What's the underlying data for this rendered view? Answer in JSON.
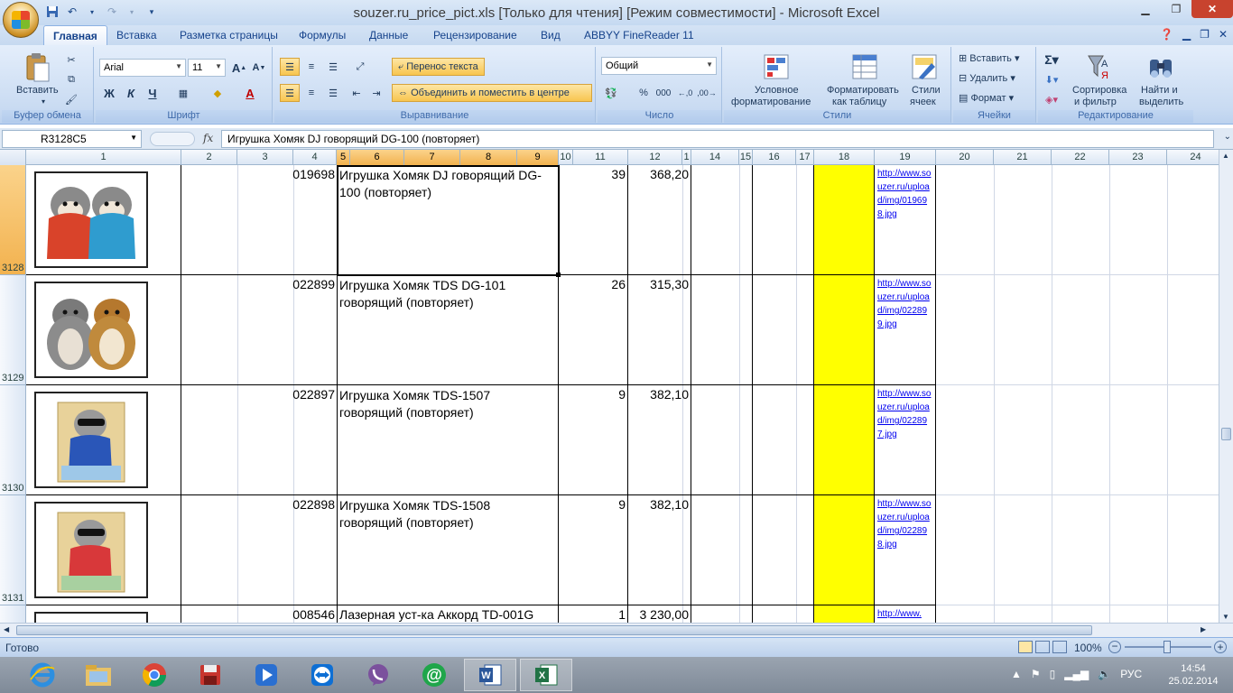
{
  "window": {
    "title": "souzer.ru_price_pict.xls  [Только для чтения]  [Режим совместимости] - Microsoft Excel"
  },
  "tabs": [
    "Главная",
    "Вставка",
    "Разметка страницы",
    "Формулы",
    "Данные",
    "Рецензирование",
    "Вид",
    "ABBYY FineReader 11"
  ],
  "ribbon": {
    "clipboard": {
      "label": "Буфер обмена",
      "paste": "Вставить"
    },
    "font": {
      "label": "Шрифт",
      "name": "Arial",
      "size": "11",
      "bold": "Ж",
      "italic": "К",
      "underline": "Ч"
    },
    "alignment": {
      "label": "Выравнивание",
      "wrap": "Перенос текста",
      "merge": "Объединить и поместить в центре"
    },
    "number": {
      "label": "Число",
      "format": "Общий",
      "percent": "%",
      "thousands": "000"
    },
    "styles": {
      "label": "Стили",
      "cond1": "Условное",
      "cond2": "форматирование",
      "table1": "Форматировать",
      "table2": "как таблицу",
      "cell1": "Стили",
      "cell2": "ячеек"
    },
    "cells": {
      "label": "Ячейки",
      "insert": "Вставить",
      "delete": "Удалить",
      "format": "Формат"
    },
    "editing": {
      "label": "Редактирование",
      "sort1": "Сортировка",
      "sort2": "и фильтр",
      "find1": "Найти и",
      "find2": "выделить"
    }
  },
  "formula_bar": {
    "name_box": "R3128C5",
    "fx": "fx",
    "content": "Игрушка Хомяк DJ говорящий DG-100 (повторяет)"
  },
  "columns": [
    "1",
    "2",
    "3",
    "4",
    "5",
    "6",
    "7",
    "8",
    "9",
    "10",
    "11",
    "12",
    "1",
    "14",
    "15",
    "16",
    "17",
    "18",
    "19",
    "20",
    "21",
    "22",
    "23",
    "24"
  ],
  "rows": [
    {
      "num": "3128",
      "code": "019698",
      "name": "Игрушка Хомяк DJ говорящий DG-100 (повторяет)",
      "qty": "39",
      "price": "368,20",
      "link": "http://www.souzer.ru/upload/img/019698.jpg"
    },
    {
      "num": "3129",
      "code": "022899",
      "name": "Игрушка Хомяк TDS DG-101 говорящий (повторяет)",
      "qty": "26",
      "price": "315,30",
      "link": "http://www.souzer.ru/upload/img/022899.jpg"
    },
    {
      "num": "3130",
      "code": "022897",
      "name": "Игрушка Хомяк TDS-1507 говорящий (повторяет)",
      "qty": "9",
      "price": "382,10",
      "link": "http://www.souzer.ru/upload/img/022897.jpg"
    },
    {
      "num": "3131",
      "code": "022898",
      "name": "Игрушка Хомяк TDS-1508 говорящий (повторяет)",
      "qty": "9",
      "price": "382,10",
      "link": "http://www.souzer.ru/upload/img/022898.jpg"
    },
    {
      "num": "",
      "code": "008546",
      "name": "Лазерная уст-ка Аккорд TD-001G",
      "qty": "1",
      "price": "3 230,00",
      "link": "http://www."
    }
  ],
  "status": {
    "ready": "Готово",
    "zoom": "100%"
  },
  "tray": {
    "lang": "РУС",
    "time": "14:54",
    "date": "25.02.2014"
  }
}
